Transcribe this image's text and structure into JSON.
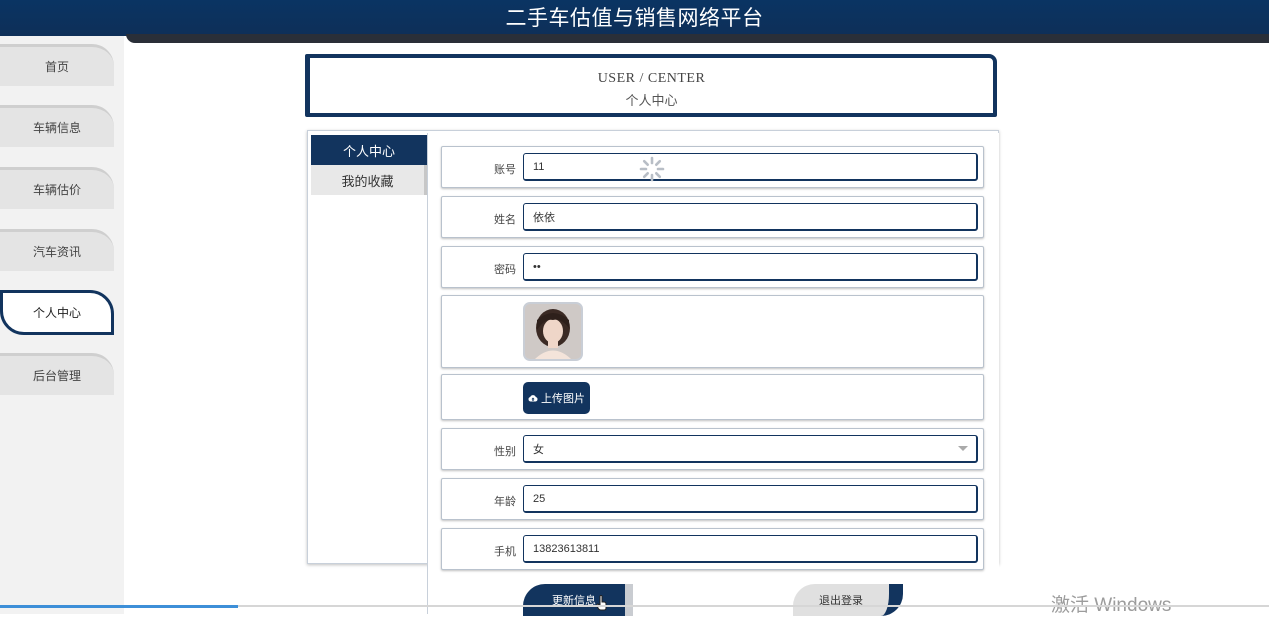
{
  "header": {
    "title": "二手车估值与销售网络平台"
  },
  "sidebar": {
    "items": [
      {
        "label": "首页",
        "active": false
      },
      {
        "label": "车辆信息",
        "active": false
      },
      {
        "label": "车辆估价",
        "active": false
      },
      {
        "label": "汽车资讯",
        "active": false
      },
      {
        "label": "个人中心",
        "active": true
      },
      {
        "label": "后台管理",
        "active": false
      }
    ]
  },
  "center_head": {
    "en": "USER / CENTER",
    "cn": "个人中心"
  },
  "tabs": [
    {
      "label": "个人中心",
      "active": true
    },
    {
      "label": "我的收藏",
      "active": false
    }
  ],
  "form": {
    "account_label": "账号",
    "account_value": "11",
    "name_label": "姓名",
    "name_value": "依依",
    "password_label": "密码",
    "password_value": "••",
    "avatar_icon": "person-photo",
    "upload_label": "上传图片",
    "upload_icon": "cloud-upload-icon",
    "gender_label": "性别",
    "gender_value": "女",
    "age_label": "年龄",
    "age_value": "25",
    "phone_label": "手机",
    "phone_value": "13823613811"
  },
  "actions": {
    "update_label": "更新信息",
    "logout_label": "退出登录"
  },
  "watermark": "激活 Windows",
  "colors": {
    "primary": "#12345e",
    "header": "#0a3463",
    "sidebar_bg": "#f2f2f2"
  }
}
